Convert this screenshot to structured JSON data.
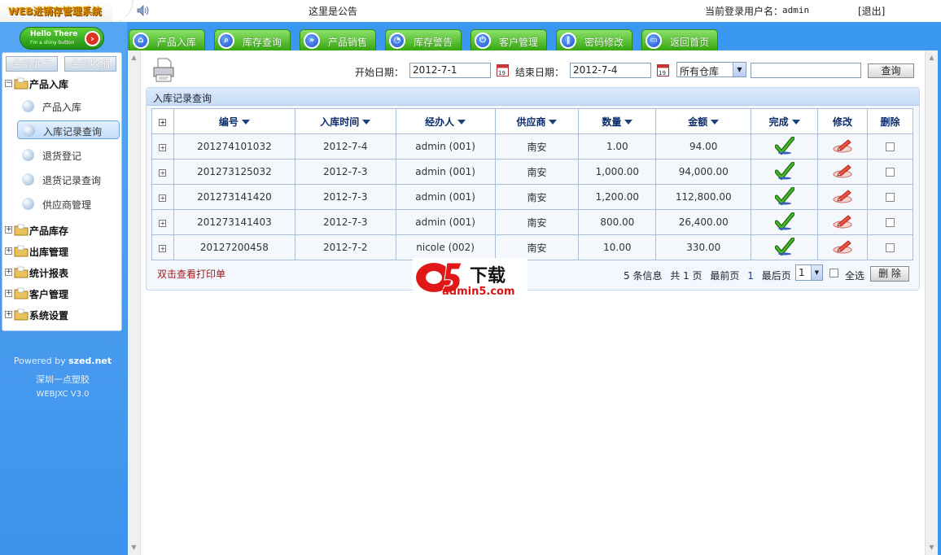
{
  "app": {
    "title": "WEB进销存管理系统"
  },
  "topbar": {
    "notice": "这里是公告",
    "login_label": "当前登录用户名：",
    "user": "admin",
    "logout": "[退出]"
  },
  "sidebar": {
    "hello_line1": "Hello There",
    "hello_line2": "I'm a shiny button",
    "expand_all": "全部展开",
    "collapse_all": "全部收缩",
    "groups": [
      "产品入库",
      "产品库存",
      "出库管理",
      "统计报表",
      "客户管理",
      "系统设置"
    ],
    "sub_items": [
      "产品入库",
      "入库记录查询",
      "退货登记",
      "退货记录查询",
      "供应商管理"
    ],
    "active_sub": "入库记录查询",
    "powered_prefix": "Powered by ",
    "powered_brand": "szed.net",
    "company": "深圳一点塑胶",
    "version": "WEBJXC V3.0"
  },
  "tabs": [
    "产品入库",
    "库存查询",
    "产品销售",
    "库存警告",
    "客户管理",
    "密码修改",
    "返回首页"
  ],
  "filter": {
    "start_label": "开始日期：",
    "start_value": "2012-7-1",
    "end_label": "结束日期：",
    "end_value": "2012-7-4",
    "warehouse": "所有仓库",
    "keyword": "",
    "query_button": "查询"
  },
  "panel": {
    "title": "入库记录查询"
  },
  "table": {
    "columns": [
      "编号",
      "入库时间",
      "经办人",
      "供应商",
      "数量",
      "金额",
      "完成",
      "修改",
      "删除"
    ],
    "rows": [
      {
        "id": "201274101032",
        "date": "2012-7-4",
        "handler": "admin (001)",
        "supplier": "南安",
        "qty": "1.00",
        "amount": "94.00"
      },
      {
        "id": "201273125032",
        "date": "2012-7-3",
        "handler": "admin (001)",
        "supplier": "南安",
        "qty": "1,000.00",
        "amount": "94,000.00"
      },
      {
        "id": "201273141420",
        "date": "2012-7-3",
        "handler": "admin (001)",
        "supplier": "南安",
        "qty": "1,200.00",
        "amount": "112,800.00"
      },
      {
        "id": "201273141403",
        "date": "2012-7-3",
        "handler": "admin (001)",
        "supplier": "南安",
        "qty": "800.00",
        "amount": "26,400.00"
      },
      {
        "id": "20127200458",
        "date": "2012-7-2",
        "handler": "nicole (002)",
        "supplier": "南安",
        "qty": "10.00",
        "amount": "330.00"
      }
    ]
  },
  "footer": {
    "hint": "双击查看打印单",
    "records": "5 条信息",
    "pages": "共 1 页",
    "first": "最前页",
    "current": "1",
    "last": "最后页",
    "page_select": "1",
    "select_all": "全选",
    "delete_button": "删 除"
  },
  "watermark": {
    "mark": "a5",
    "text": "下载",
    "site": "admin5.com"
  },
  "colors": {
    "sidebar_blue": "#3a98f0",
    "tab_green": "#35a70f",
    "header_navy": "#0c2d6b"
  }
}
